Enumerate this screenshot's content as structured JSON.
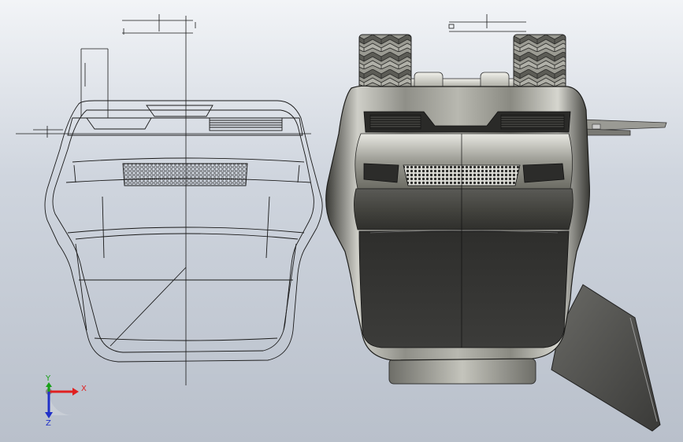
{
  "viewport": {
    "background_top": "#f2f4f7",
    "background_bottom": "#b9c0cb"
  },
  "triad": {
    "x_label": "X",
    "y_label": "Y",
    "z_label": "Z",
    "x_color": "#e02020",
    "y_color": "#18a018",
    "z_color": "#2030c8"
  },
  "models": [
    {
      "name": "wireframe-view",
      "style": "hidden-lines-visible"
    },
    {
      "name": "shaded-view",
      "style": "shaded-with-edges"
    }
  ]
}
